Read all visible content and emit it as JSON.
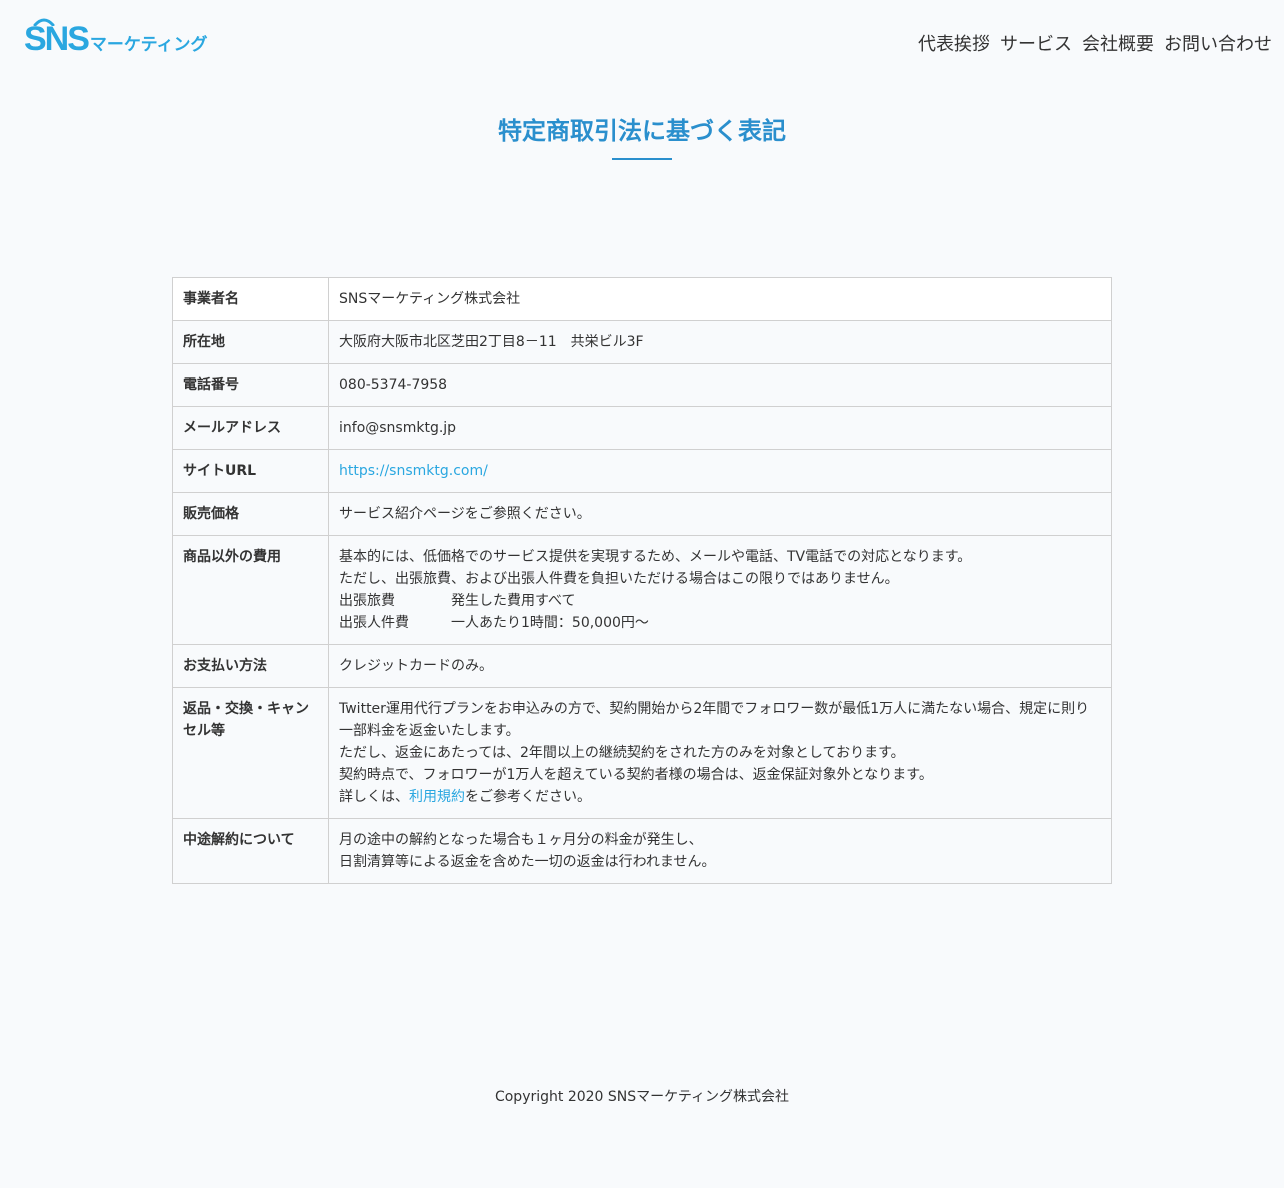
{
  "header": {
    "logo_main": "SNS",
    "logo_sub": "マーケティング",
    "nav": [
      "代表挨拶",
      "サービス",
      "会社概要",
      "お問い合わせ"
    ]
  },
  "page_title": "特定商取引法に基づく表記",
  "rows": {
    "business_name": {
      "label": "事業者名",
      "value": "SNSマーケティング株式会社"
    },
    "address": {
      "label": "所在地",
      "value": "大阪府大阪市北区芝田2丁目8－11　共栄ビル3F"
    },
    "phone": {
      "label": "電話番号",
      "value": "080-5374-7958"
    },
    "email": {
      "label": "メールアドレス",
      "value": "info@snsmktg.jp"
    },
    "site_url": {
      "label": "サイトURL",
      "value": "https://snsmktg.com/"
    },
    "price": {
      "label": "販売価格",
      "value": "サービス紹介ページをご参照ください。"
    },
    "other_costs": {
      "label": "商品以外の費用",
      "line1": "基本的には、低価格でのサービス提供を実現するため、メールや電話、TV電話での対応となります。",
      "line2": "ただし、出張旅費、および出張人件費を負担いただける場合はこの限りではありません。",
      "item1_key": "出張旅費",
      "item1_val": "発生した費用すべて",
      "item2_key": "出張人件費",
      "item2_val": "一人あたり1時間：50,000円～"
    },
    "payment": {
      "label": "お支払い方法",
      "value": "クレジットカードのみ。"
    },
    "returns": {
      "label": "返品・交換・キャンセル等",
      "line1": "Twitter運用代行プランをお申込みの方で、契約開始から2年間でフォロワー数が最低1万人に満たない場合、規定に則り一部料金を返金いたします。",
      "line2": "ただし、返金にあたっては、2年間以上の継続契約をされた方のみを対象としております。",
      "line3": "契約時点で、フォロワーが1万人を超えている契約者様の場合は、返金保証対象外となります。",
      "line4_pre": "詳しくは、",
      "line4_link": "利用規約",
      "line4_post": "をご参考ください。"
    },
    "cancel": {
      "label": "中途解約について",
      "line1": "月の途中の解約となった場合も１ヶ月分の料金が発生し、",
      "line2": "日割清算等による返金を含めた一切の返金は行われません。"
    }
  },
  "footer": {
    "copyright": "Copyright 2020 SNSマーケティング株式会社"
  },
  "colors": {
    "accent": "#2aa7e0",
    "title": "#2a8fcd",
    "background": "#f8fafc",
    "border": "#d0d0d0"
  }
}
